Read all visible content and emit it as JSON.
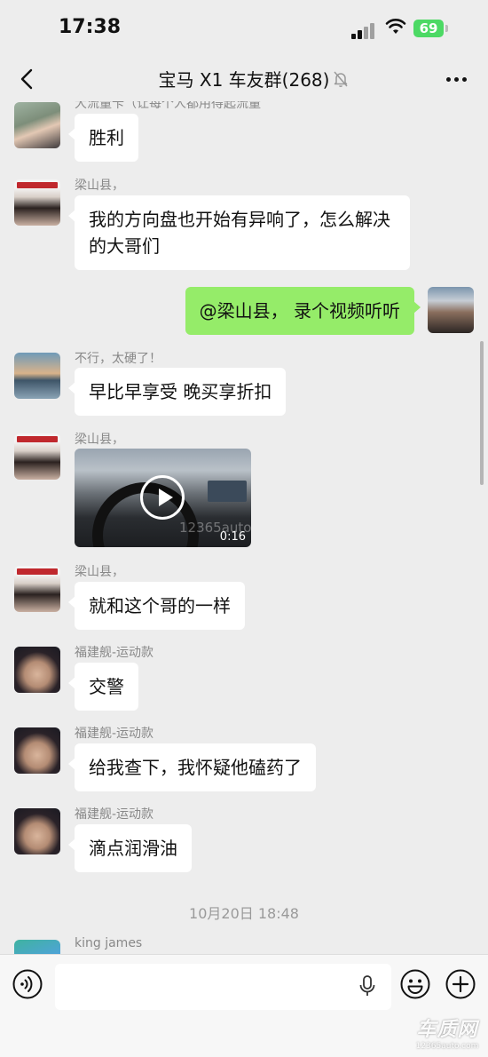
{
  "status_bar": {
    "time": "17:38",
    "battery": "69"
  },
  "header": {
    "title": "宝马 X1 车友群(268)"
  },
  "messages": [
    {
      "sender": "大流量卡（让每个人都用得起流量",
      "text": "胜利"
    },
    {
      "sender": "梁山县，",
      "text": "我的方向盘也开始有异响了，怎么解决的大哥们"
    },
    {
      "text": "@梁山县， 录个视频听听"
    },
    {
      "sender": "不行，太硬了！",
      "text": "早比早享受 晚买享折扣"
    },
    {
      "sender": "梁山县，",
      "video_duration": "0:16",
      "video_watermark": "12365auto.com"
    },
    {
      "sender": "梁山县，",
      "text": "就和这个哥的一样"
    },
    {
      "sender": "福建舰-运动款",
      "text": "交警"
    },
    {
      "sender": "福建舰-运动款",
      "text": "给我查下，我怀疑他磕药了"
    },
    {
      "sender": "福建舰-运动款",
      "text": "滴点润滑油"
    },
    {
      "timestamp": "10月20日 18:48"
    },
    {
      "sender": "king james"
    }
  ],
  "input": {
    "value": ""
  },
  "watermark": {
    "logo": "车质网",
    "url": "12365auto.com"
  },
  "icons": [
    "signal-icon",
    "wifi-icon",
    "battery-icon",
    "back-icon",
    "mute-icon",
    "more-icon",
    "play-icon",
    "voice-icon",
    "mic-icon",
    "emoji-icon",
    "plus-icon"
  ],
  "colors": {
    "background": "#ededed",
    "bubble_self": "#95ec69",
    "bubble_other": "#ffffff",
    "battery": "#4cd964"
  }
}
